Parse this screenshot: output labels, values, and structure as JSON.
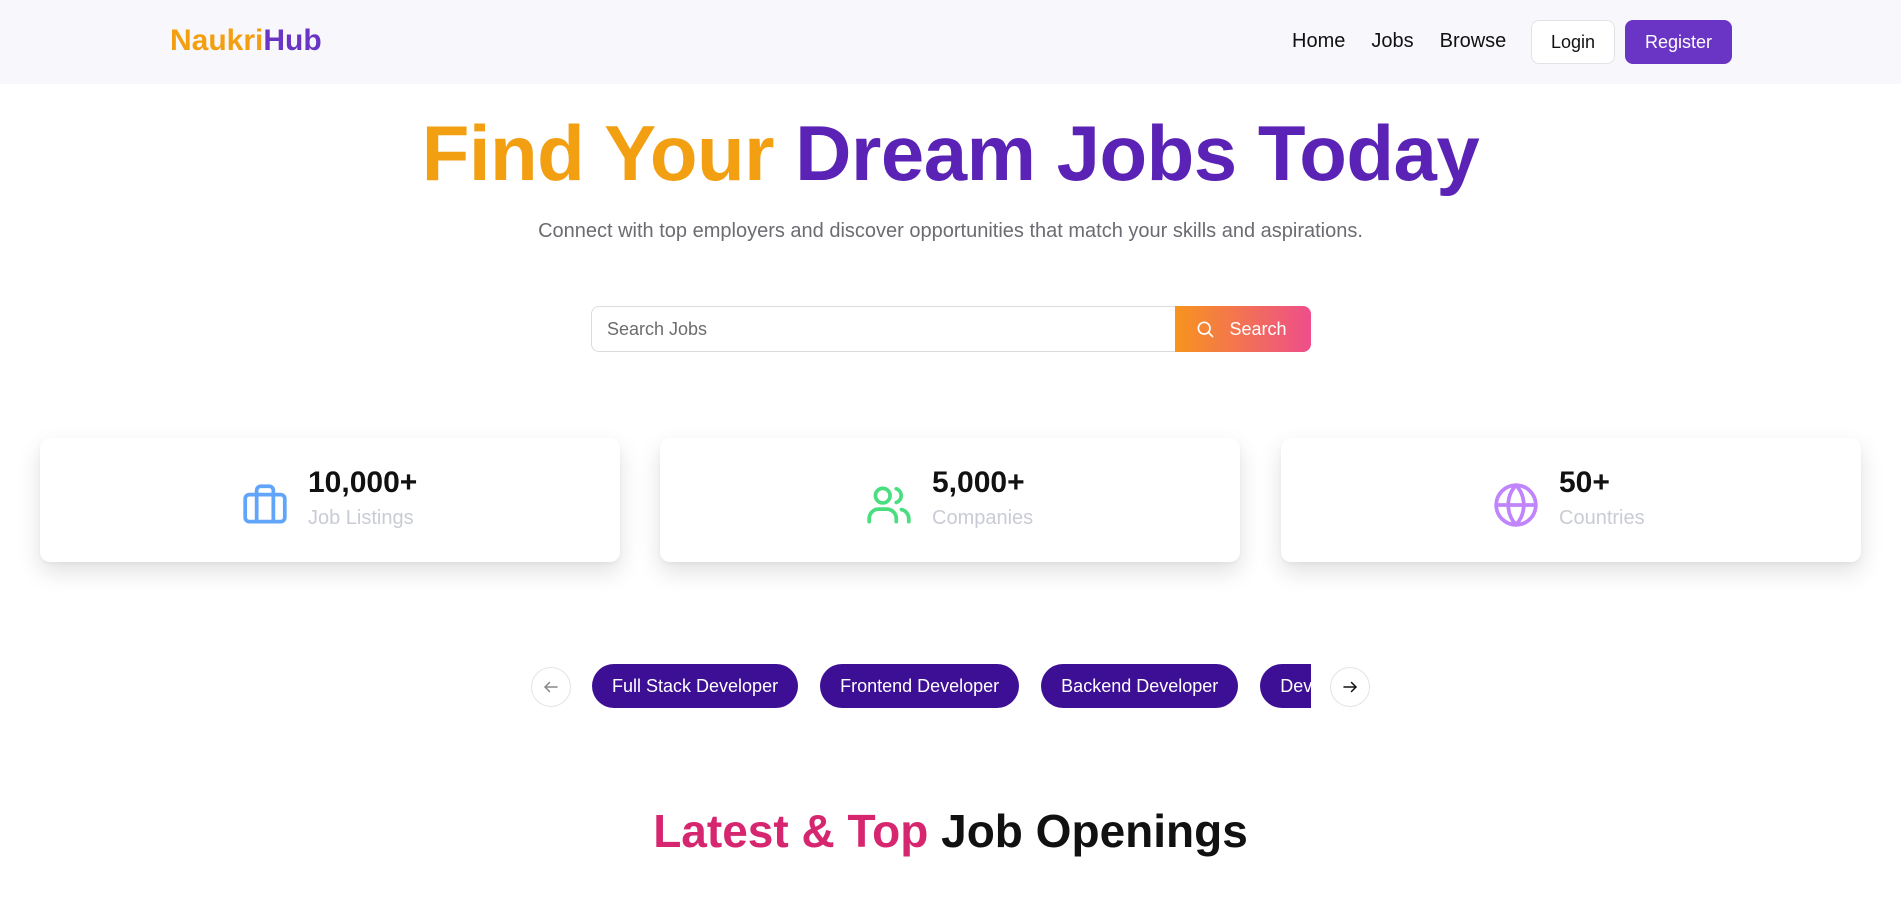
{
  "navbar": {
    "logo_part1": "Naukri",
    "logo_part2": "Hub",
    "links": [
      "Home",
      "Jobs",
      "Browse"
    ],
    "login_label": "Login",
    "register_label": "Register"
  },
  "hero": {
    "title_part1": "Find Your",
    "title_part2": "Dream Jobs Today",
    "subtitle": "Connect with top employers and discover opportunities that match your skills and aspirations."
  },
  "search": {
    "placeholder": "Search Jobs",
    "button_label": "Search"
  },
  "stats": [
    {
      "icon": "briefcase-icon",
      "value": "10,000+",
      "label": "Job Listings",
      "color": "#60a5fa"
    },
    {
      "icon": "users-icon",
      "value": "5,000+",
      "label": "Companies",
      "color": "#4ade80"
    },
    {
      "icon": "globe-icon",
      "value": "50+",
      "label": "Countries",
      "color": "#c084fc"
    }
  ],
  "categories": [
    "Full Stack Developer",
    "Frontend Developer",
    "Backend Developer",
    "DevOps Engineer"
  ],
  "section": {
    "title_part1": "Latest & Top",
    "title_part2": "Job Openings"
  },
  "colors": {
    "brand_orange": "#f29f12",
    "brand_purple": "#6a35c4",
    "chip_bg": "#3d0f94",
    "accent_pink": "#d6266f"
  }
}
